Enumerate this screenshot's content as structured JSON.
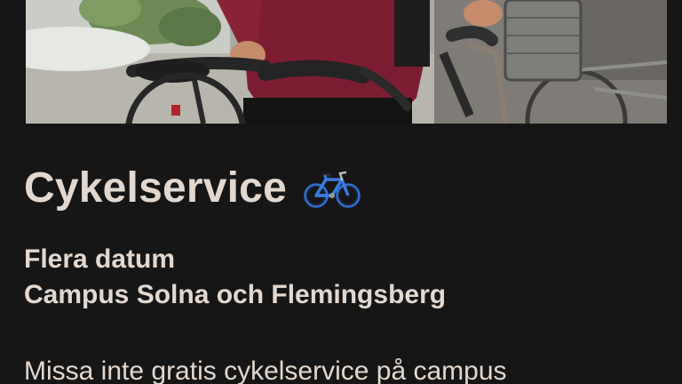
{
  "event": {
    "title": "Cykelservice",
    "title_icon": "bicycle-icon",
    "date_label": "Flera datum",
    "location_label": "Campus Solna och Flemingsberg",
    "description": "Missa inte gratis cykelservice på campus"
  },
  "hero_image": {
    "subject": "person in burgundy sweater walking a bicycle"
  },
  "colors": {
    "background": "#161616",
    "text": "#e3d8cf",
    "bike_icon": "#2f6fd0"
  }
}
